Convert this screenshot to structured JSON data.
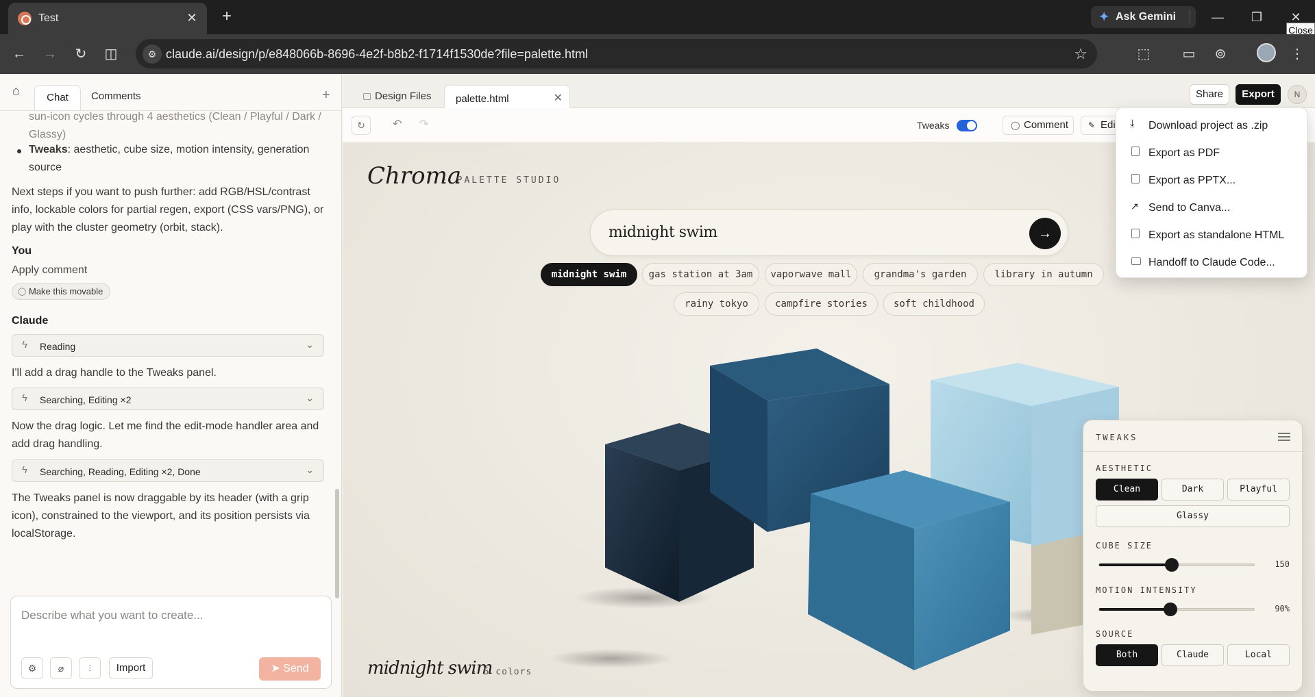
{
  "browser": {
    "tab_title": "Test",
    "tab_close": "✕",
    "new_tab": "+",
    "gemini_label": "Ask Gemini",
    "url": "claude.ai/design/p/e848066b-8696-4e2f-b8b2-f1714f1530de?file=palette.html",
    "close_tooltip": "Close",
    "icons": [
      "back-icon",
      "forward-icon",
      "reload-icon",
      "split-view-icon",
      "site-info-icon",
      "bookmark-star-icon",
      "extensions-icon",
      "cast-icon",
      "incognito-icon",
      "profile-avatar",
      "menu-dots-icon"
    ]
  },
  "chat": {
    "tabs": {
      "chat": "Chat",
      "comments": "Comments"
    },
    "add_label": "+",
    "partial_text": "sun-icon cycles through 4 aesthetics (Clean / Playful / Dark / Glassy)",
    "bullet_bold": "Tweaks",
    "bullet_text": ": aesthetic, cube size, motion intensity, generation source",
    "next_steps": "Next steps if you want to push further: add RGB/HSL/contrast info, lockable colors for partial regen, export (CSS vars/PNG), or play with the cluster geometry (orbit, stack).",
    "you_label": "You",
    "you_message": "Apply comment",
    "you_pill": "Make this movable",
    "claude_label": "Claude",
    "tool1": "Reading",
    "msg1": "I'll add a drag handle to the Tweaks panel.",
    "tool2": "Searching, Editing ×2",
    "msg2": "Now the drag logic. Let me find the edit-mode handler area and add drag handling.",
    "tool3": "Searching, Reading, Editing ×2, Done",
    "msg3": "The Tweaks panel is now draggable by its header (with a grip icon), constrained to the viewport, and its position persists via localStorage.",
    "composer": {
      "placeholder": "Describe what you want to create...",
      "import_label": "Import",
      "send_label": "Send"
    }
  },
  "design": {
    "files_tab": "Design Files",
    "file_tab": "palette.html",
    "share_label": "Share",
    "export_label": "Export",
    "avatar_initial": "N",
    "tweaks_label": "Tweaks",
    "tweaks_on": true,
    "comment_label": "Comment",
    "edit_label": "Edit"
  },
  "canvas": {
    "title": "Chroma",
    "subtitle": "· PALETTE STUDIO",
    "prompt": "midnight swim",
    "chips_row1": [
      "midnight swim",
      "gas station at 3am",
      "vaporwave mall",
      "grandma's garden",
      "library in autumn"
    ],
    "chips_row2": [
      "rainy tokyo",
      "campfire stories",
      "soft childhood"
    ],
    "active_chip": "midnight swim",
    "result_title": "midnight swim",
    "result_count": "· 5 colors",
    "cube_colors": [
      "#1f3447",
      "#25506e",
      "#3a7ea3",
      "#a3cfe2",
      "#c8c4b0"
    ]
  },
  "tweaks": {
    "header": "TWEAKS",
    "aesthetic_label": "AESTHETIC",
    "aesthetic_options": [
      "Clean",
      "Dark",
      "Playful",
      "Glassy"
    ],
    "aesthetic_selected": "Clean",
    "cube_size_label": "CUBE SIZE",
    "cube_size_value": "150",
    "cube_size_fraction": 0.47,
    "motion_label": "MOTION INTENSITY",
    "motion_value": "90%",
    "motion_fraction": 0.46,
    "source_label": "SOURCE",
    "source_options": [
      "Both",
      "Claude",
      "Local"
    ],
    "source_selected": "Both"
  },
  "export_menu": {
    "items": [
      "Download project as .zip",
      "Export as PDF",
      "Export as PPTX...",
      "Send to Canva...",
      "Export as standalone HTML",
      "Handoff to Claude Code..."
    ]
  }
}
